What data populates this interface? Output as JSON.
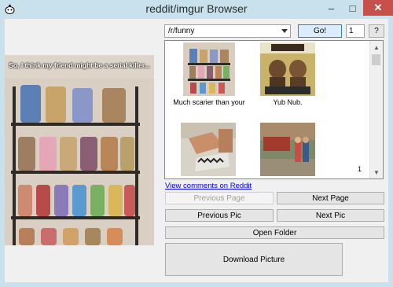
{
  "window": {
    "title": "reddit/imgur Browser",
    "minimize_label": "–",
    "maximize_label": "□",
    "close_label": "✕"
  },
  "preview": {
    "caption": "So, I think my friend might be a serial killer..."
  },
  "toolbar": {
    "subreddit_value": "/r/funny",
    "go_label": "Go!",
    "page_value": "1",
    "help_label": "?"
  },
  "thumbnails": [
    {
      "label": "Much scarier than your"
    },
    {
      "label": "Yub Nub."
    },
    {
      "label": ""
    },
    {
      "label": ""
    }
  ],
  "list": {
    "page_number": "1"
  },
  "links": {
    "view_comments": "View comments on Reddit"
  },
  "buttons": {
    "previous_page": "Previous Page",
    "next_page": "Next Page",
    "previous_pic": "Previous Pic",
    "next_pic": "Next Pic",
    "open_folder": "Open Folder",
    "download_picture": "Download Picture"
  },
  "colors": {
    "title_bar": "#c8e1ed",
    "close_button": "#c7504b",
    "link": "#0000ee"
  }
}
